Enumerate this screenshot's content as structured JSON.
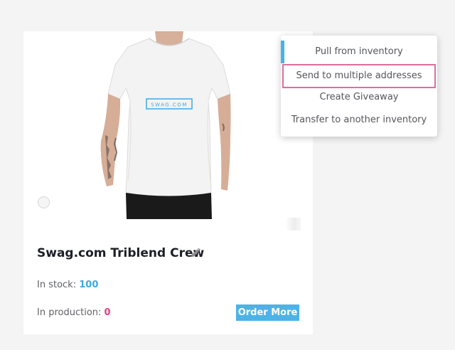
{
  "product": {
    "title": "Swag.com Triblend Crew",
    "image": {
      "shirt_print": "SWAG.COM",
      "alt": ""
    },
    "stock": {
      "label": "In stock:",
      "value": "100"
    },
    "production": {
      "label": "In production:",
      "value": "0"
    },
    "order_button_label": "Order More"
  },
  "menu": {
    "items": [
      {
        "label": "Pull from inventory"
      },
      {
        "label": "Send to multiple addresses"
      },
      {
        "label": "Create Giveaway"
      },
      {
        "label": "Transfer to another inventory"
      }
    ]
  },
  "colors": {
    "accent_blue": "#44b4ee",
    "stock_blue": "#3ba9e6",
    "production_pink": "#e23f82",
    "highlight_border": "#dd6f9a",
    "button_blue": "#4db3e6"
  },
  "icons": {
    "edit": "pencil-icon",
    "select": "radio-circle"
  }
}
